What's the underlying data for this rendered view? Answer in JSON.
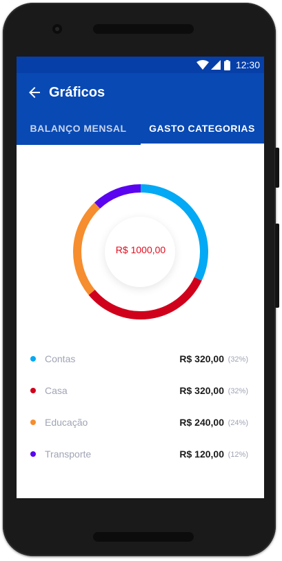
{
  "status_bar": {
    "time": "12:30",
    "wifi_icon": "wifi-icon",
    "signal_icon": "signal-icon",
    "battery_icon": "battery-icon"
  },
  "app_bar": {
    "back_icon": "arrow-left-icon",
    "title": "Gráficos"
  },
  "tabs": [
    {
      "label": "BALANÇO MENSAL",
      "active": false
    },
    {
      "label": "GASTO CATEGORIAS",
      "active": true
    }
  ],
  "chart_data": {
    "type": "pie",
    "donut": true,
    "center_label": "R$ 1000,00",
    "categories": [
      "Contas",
      "Casa",
      "Educação",
      "Transporte"
    ],
    "values": [
      320,
      320,
      240,
      120
    ],
    "colors": [
      "#03a9f4",
      "#d0021b",
      "#f68d2e",
      "#5a04f0"
    ]
  },
  "legend": [
    {
      "label": "Contas",
      "amount": "R$ 320,00",
      "percent": "(32%)",
      "color": "#03a9f4"
    },
    {
      "label": "Casa",
      "amount": "R$ 320,00",
      "percent": "(32%)",
      "color": "#d0021b"
    },
    {
      "label": "Educação",
      "amount": "R$ 240,00",
      "percent": "(24%)",
      "color": "#f68d2e"
    },
    {
      "label": "Transporte",
      "amount": "R$ 120,00",
      "percent": "(12%)",
      "color": "#5a04f0"
    }
  ],
  "colors": {
    "header": "#0849b3",
    "status_bar": "#063fa8",
    "center_text": "#e30b1d"
  }
}
